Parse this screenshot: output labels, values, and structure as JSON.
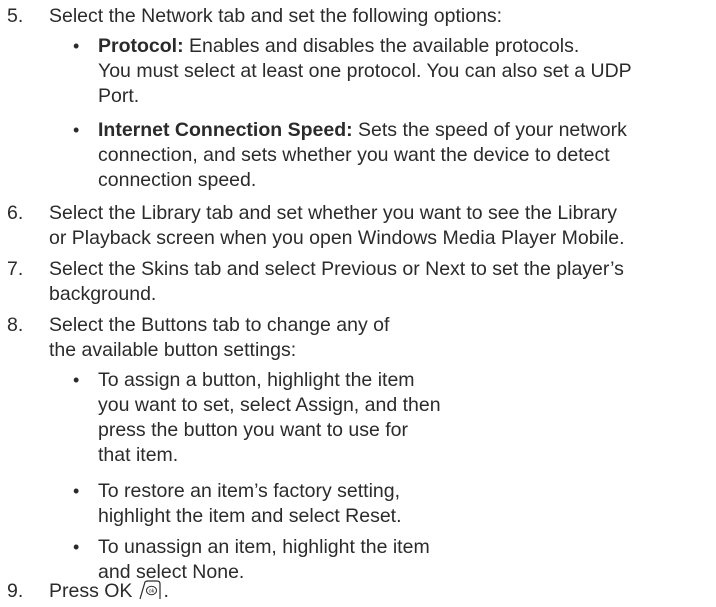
{
  "steps": [
    {
      "num": "5.",
      "lines": [
        "Select the Network tab and set the following options:"
      ]
    },
    {
      "num": "6.",
      "lines": [
        "Select the Library tab and set whether you want to see the Library",
        "or Playback screen when you open Windows Media Player Mobile."
      ]
    },
    {
      "num": "7.",
      "lines": [
        "Select the Skins tab and select Previous or Next to set the player’s",
        "background."
      ]
    },
    {
      "num": "8.",
      "lines": [
        "Select the Buttons tab to change any of",
        "the available button settings:"
      ]
    },
    {
      "num": "9.",
      "text": "Press OK"
    }
  ],
  "network_bullets": [
    {
      "term": "Protocol:",
      "lines": [
        " Enables and disables the available protocols.",
        "You must select at least one protocol. You can also set a UDP",
        "Port."
      ]
    },
    {
      "term": "Internet Connection Speed:",
      "lines": [
        " Sets the speed of your network",
        "connection, and sets whether you want the device to detect",
        "connection speed."
      ]
    }
  ],
  "button_bullets": [
    {
      "lines": [
        "To assign a button, highlight the item",
        "you want to set, select Assign, and then",
        "press the button you want to use for",
        "that item."
      ]
    },
    {
      "lines": [
        "To restore an item’s factory setting,",
        "highlight the item and select Reset."
      ]
    },
    {
      "lines": [
        "To unassign an item, highlight the item",
        "and select None."
      ]
    }
  ],
  "bullet_char": "•",
  "period": ".",
  "icons": {
    "ok": "ok-button-icon"
  }
}
